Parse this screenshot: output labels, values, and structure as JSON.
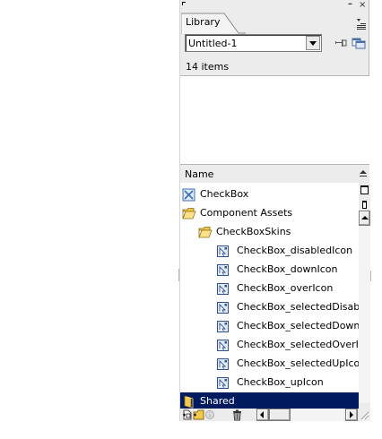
{
  "panel": {
    "tab_label": "Library",
    "document_select": {
      "value": "Untitled-1"
    },
    "item_count": "14 items",
    "column_header": "Name"
  },
  "items": [
    {
      "label": "CheckBox",
      "icon": "component-icon",
      "depth": 0
    },
    {
      "label": "Component Assets",
      "icon": "folder-open-icon",
      "depth": 0
    },
    {
      "label": "CheckBoxSkins",
      "icon": "folder-open-icon",
      "depth": 1
    },
    {
      "label": "CheckBox_disabledIcon",
      "icon": "movie-clip-icon",
      "depth": 2
    },
    {
      "label": "CheckBox_downIcon",
      "icon": "movie-clip-icon",
      "depth": 2
    },
    {
      "label": "CheckBox_overIcon",
      "icon": "movie-clip-icon",
      "depth": 2
    },
    {
      "label": "CheckBox_selectedDisablec",
      "icon": "movie-clip-icon",
      "depth": 2
    },
    {
      "label": "CheckBox_selectedDownIcc",
      "icon": "movie-clip-icon",
      "depth": 2
    },
    {
      "label": "CheckBox_selectedOverIco",
      "icon": "movie-clip-icon",
      "depth": 2
    },
    {
      "label": "CheckBox_selectedUpIcon",
      "icon": "movie-clip-icon",
      "depth": 2
    },
    {
      "label": "CheckBox_upIcon",
      "icon": "movie-clip-icon",
      "depth": 2
    },
    {
      "label": "Shared",
      "icon": "folder-closed-icon",
      "depth": 0,
      "selected": true
    }
  ],
  "colors": {
    "panel_bg": "#ececec",
    "selection_bg": "#001a5f",
    "folder_yellow": "#f2c94c",
    "component_blue": "#3a6fb0"
  }
}
